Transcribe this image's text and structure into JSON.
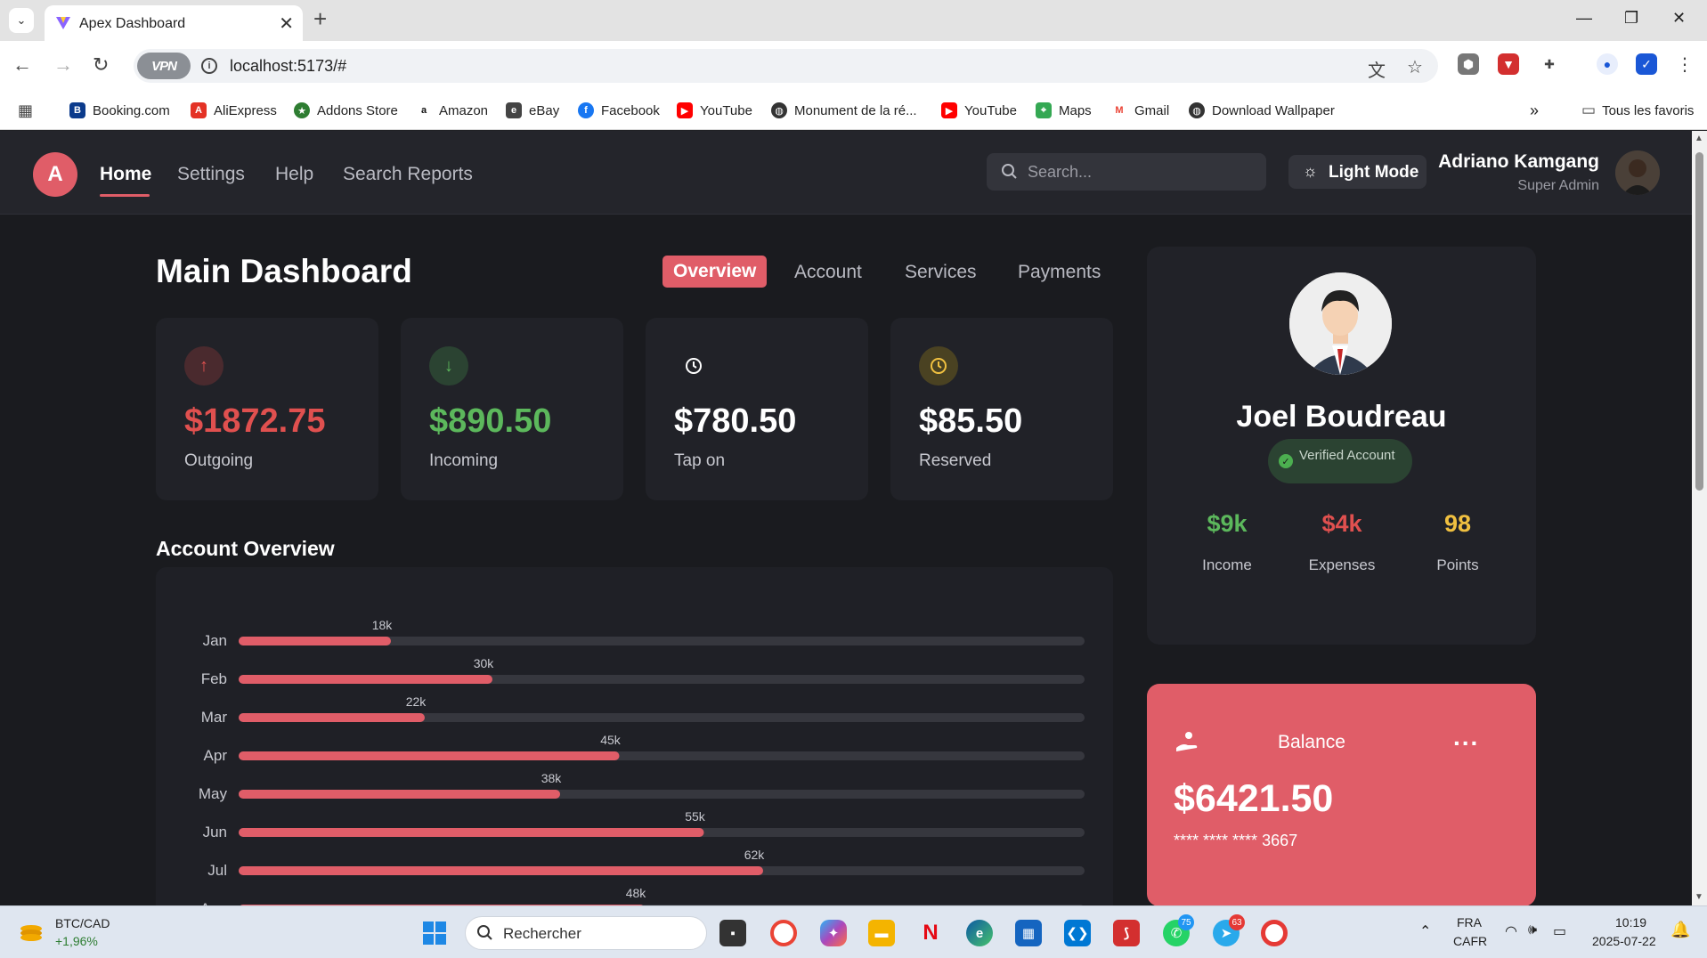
{
  "browser": {
    "tab_title": "Apex Dashboard",
    "url": "localhost:5173/#",
    "vpn_label": "VPN",
    "bookmarks": [
      "Booking.com",
      "AliExpress",
      "Addons Store",
      "Amazon",
      "eBay",
      "Facebook",
      "YouTube",
      "Monument de la ré...",
      "YouTube",
      "Maps",
      "Gmail",
      "Download Wallpaper"
    ],
    "all_bookmarks": "Tous les favoris"
  },
  "nav": {
    "logo_letter": "A",
    "links": [
      "Home",
      "Settings",
      "Help",
      "Search Reports"
    ],
    "search_placeholder": "Search...",
    "mode_button": "Light Mode",
    "user_name": "Adriano Kamgang",
    "user_role": "Super Admin"
  },
  "main": {
    "title": "Main Dashboard",
    "tabs": [
      "Overview",
      "Account",
      "Services",
      "Payments"
    ],
    "stats": [
      {
        "value": "$1872.75",
        "label": "Outgoing",
        "icon": "arrow-up-icon",
        "color": "#e0504f"
      },
      {
        "value": "$890.50",
        "label": "Incoming",
        "icon": "arrow-down-icon",
        "color": "#5cb85c"
      },
      {
        "value": "$780.50",
        "label": "Tap on",
        "icon": "clock-icon",
        "color": "#ffffff"
      },
      {
        "value": "$85.50",
        "label": "Reserved",
        "icon": "clock-icon",
        "color": "#ffffff"
      }
    ],
    "overview_title": "Account Overview"
  },
  "chart_data": {
    "type": "bar",
    "orientation": "horizontal",
    "categories": [
      "Jan",
      "Feb",
      "Mar",
      "Apr",
      "May",
      "Jun",
      "Jul",
      "Aug"
    ],
    "values": [
      18,
      30,
      22,
      45,
      38,
      55,
      62,
      48
    ],
    "data_labels": [
      "18k",
      "30k",
      "22k",
      "45k",
      "38k",
      "55k",
      "62k",
      "48k"
    ],
    "xlim": [
      0,
      100
    ],
    "bar_color": "#e05d68",
    "track_color": "#36373e"
  },
  "profile": {
    "name": "Joel Boudreau",
    "verified": "Verified Account",
    "stats": [
      {
        "value": "$9k",
        "label": "Income",
        "color": "#5cb85c"
      },
      {
        "value": "$4k",
        "label": "Expenses",
        "color": "#e0504f"
      },
      {
        "value": "98",
        "label": "Points",
        "color": "#f0c040"
      }
    ]
  },
  "balance": {
    "title": "Balance",
    "more": "...",
    "amount": "$6421.50",
    "card_mask": "**** **** ****",
    "card_last": "3667"
  },
  "taskbar": {
    "ticker_name": "BTC/CAD",
    "ticker_change": "+1,96%",
    "search_placeholder": "Rechercher",
    "lang": "FRA",
    "region": "CAFR",
    "time": "10:19",
    "date": "2025-07-22",
    "whatsapp_badge": "75",
    "telegram_badge": "63"
  }
}
